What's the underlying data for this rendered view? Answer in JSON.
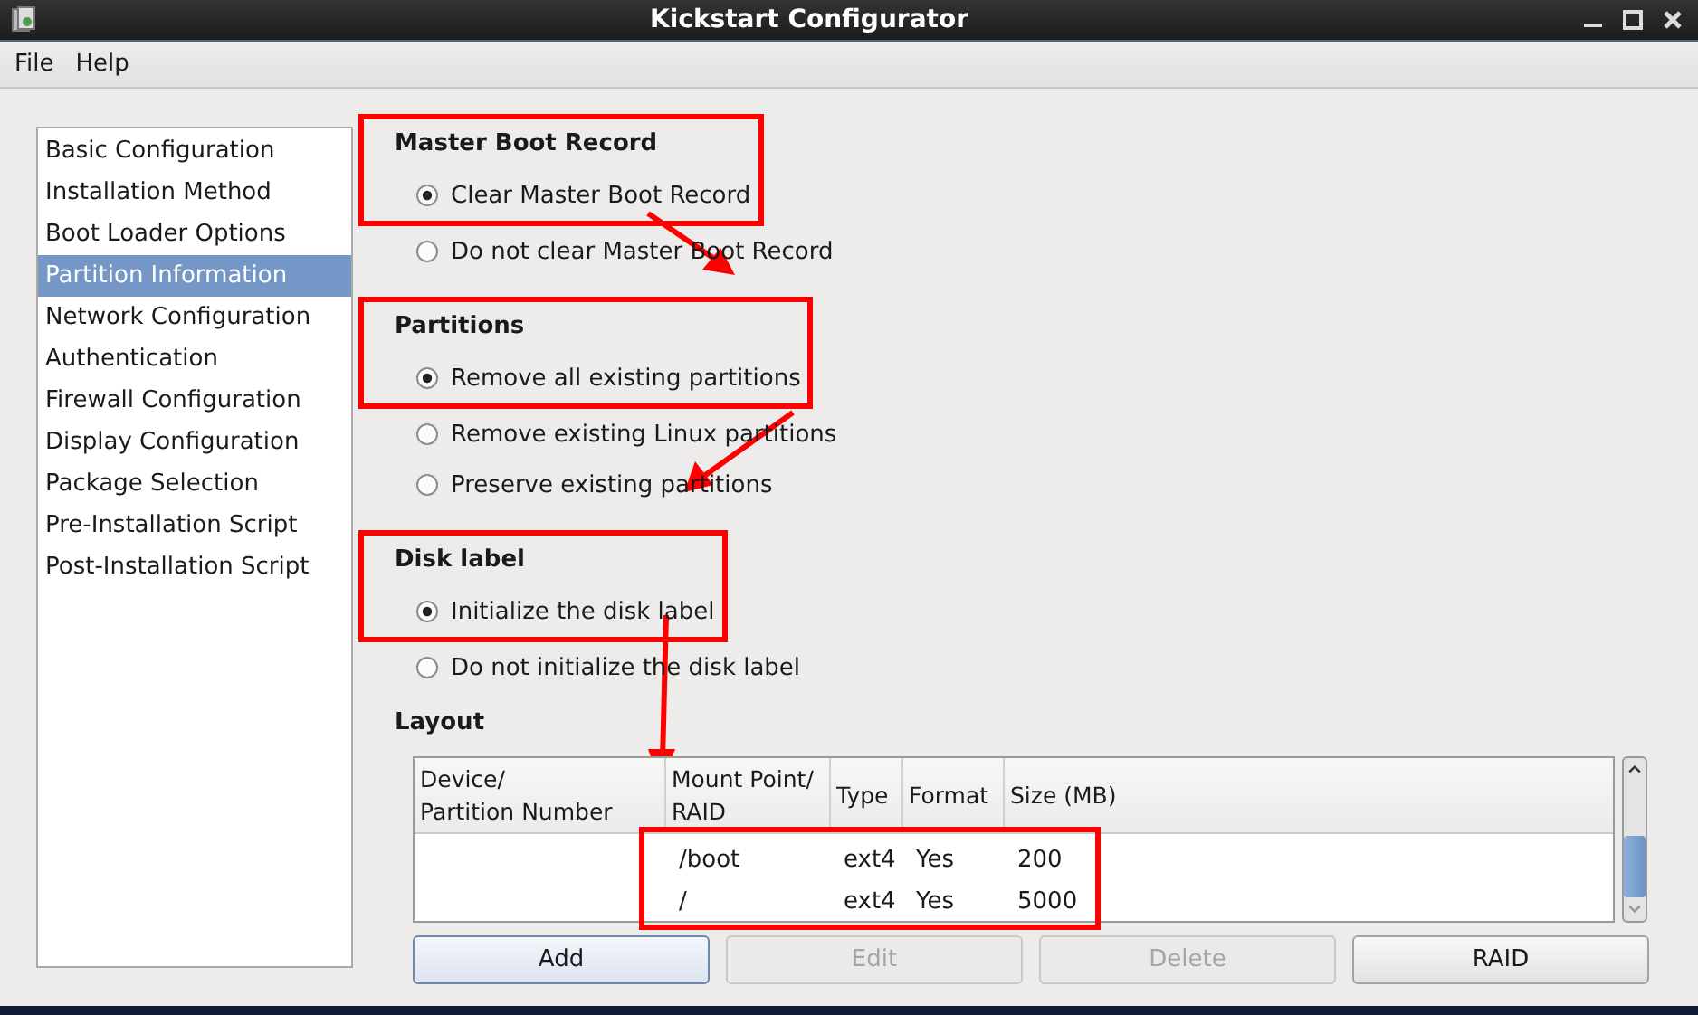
{
  "window": {
    "title": "Kickstart Configurator"
  },
  "menu": [
    "File",
    "Help"
  ],
  "sidebar": {
    "items": [
      {
        "label": "Basic Configuration",
        "selected": false
      },
      {
        "label": "Installation Method",
        "selected": false
      },
      {
        "label": "Boot Loader Options",
        "selected": false
      },
      {
        "label": "Partition Information",
        "selected": true
      },
      {
        "label": "Network Configuration",
        "selected": false
      },
      {
        "label": "Authentication",
        "selected": false
      },
      {
        "label": "Firewall Configuration",
        "selected": false
      },
      {
        "label": "Display Configuration",
        "selected": false
      },
      {
        "label": "Package Selection",
        "selected": false
      },
      {
        "label": "Pre-Installation Script",
        "selected": false
      },
      {
        "label": "Post-Installation Script",
        "selected": false
      }
    ]
  },
  "groups": [
    {
      "heading": "Master Boot Record",
      "highlighted": true,
      "options": [
        {
          "label": "Clear Master Boot Record",
          "selected": true
        },
        {
          "label": "Do not clear Master Boot Record",
          "selected": false
        }
      ]
    },
    {
      "heading": "Partitions",
      "highlighted": true,
      "options": [
        {
          "label": "Remove all existing partitions",
          "selected": true
        },
        {
          "label": "Remove existing Linux partitions",
          "selected": false
        },
        {
          "label": "Preserve existing partitions",
          "selected": false
        }
      ]
    },
    {
      "heading": "Disk label",
      "highlighted": true,
      "options": [
        {
          "label": "Initialize the disk label",
          "selected": true
        },
        {
          "label": "Do not initialize the disk label",
          "selected": false
        }
      ]
    }
  ],
  "layout": {
    "heading": "Layout",
    "highlighted": true,
    "columns": [
      "Device/\nPartition Number",
      "Mount Point/\nRAID",
      "Type",
      "Format",
      "Size (MB)"
    ],
    "rows": [
      {
        "mount_point": "/boot",
        "type": "ext4",
        "format": "Yes",
        "size": "200"
      },
      {
        "mount_point": "/",
        "type": "ext4",
        "format": "Yes",
        "size": "5000"
      }
    ]
  },
  "buttons": [
    {
      "label": "Add",
      "disabled": false
    },
    {
      "label": "Edit",
      "disabled": true
    },
    {
      "label": "Delete",
      "disabled": true
    },
    {
      "label": "RAID",
      "disabled": false
    }
  ]
}
